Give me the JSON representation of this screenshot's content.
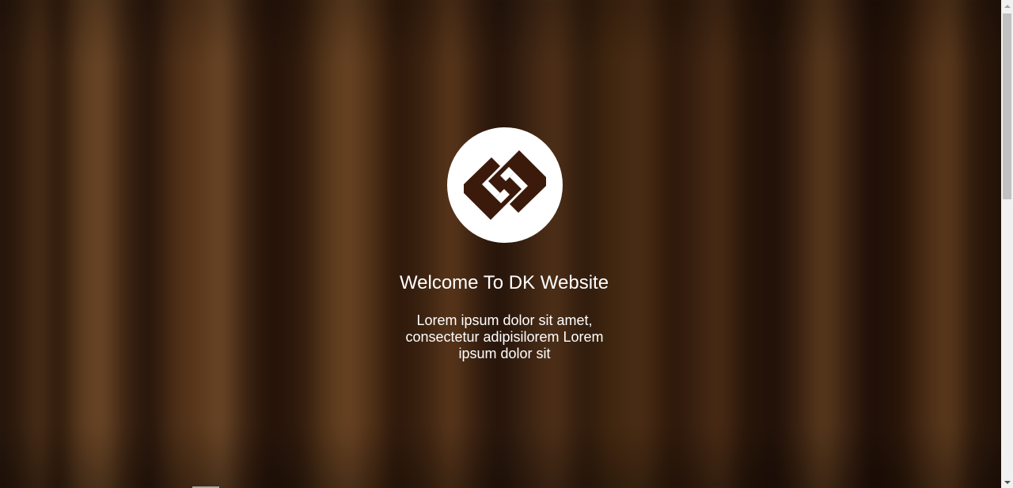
{
  "page": {
    "heading": "Welcome To DK Website",
    "description": "Lorem ipsum dolor sit amet, consectetur adipisilorem Lorem ipsum dolor sit"
  },
  "logo": {
    "icon": "interlocking-brackets-logo-icon",
    "color": "#3b1a0c",
    "background": "#ffffff"
  },
  "theme": {
    "background": "blurred-dark-wood",
    "text_color": "#ffffff"
  }
}
